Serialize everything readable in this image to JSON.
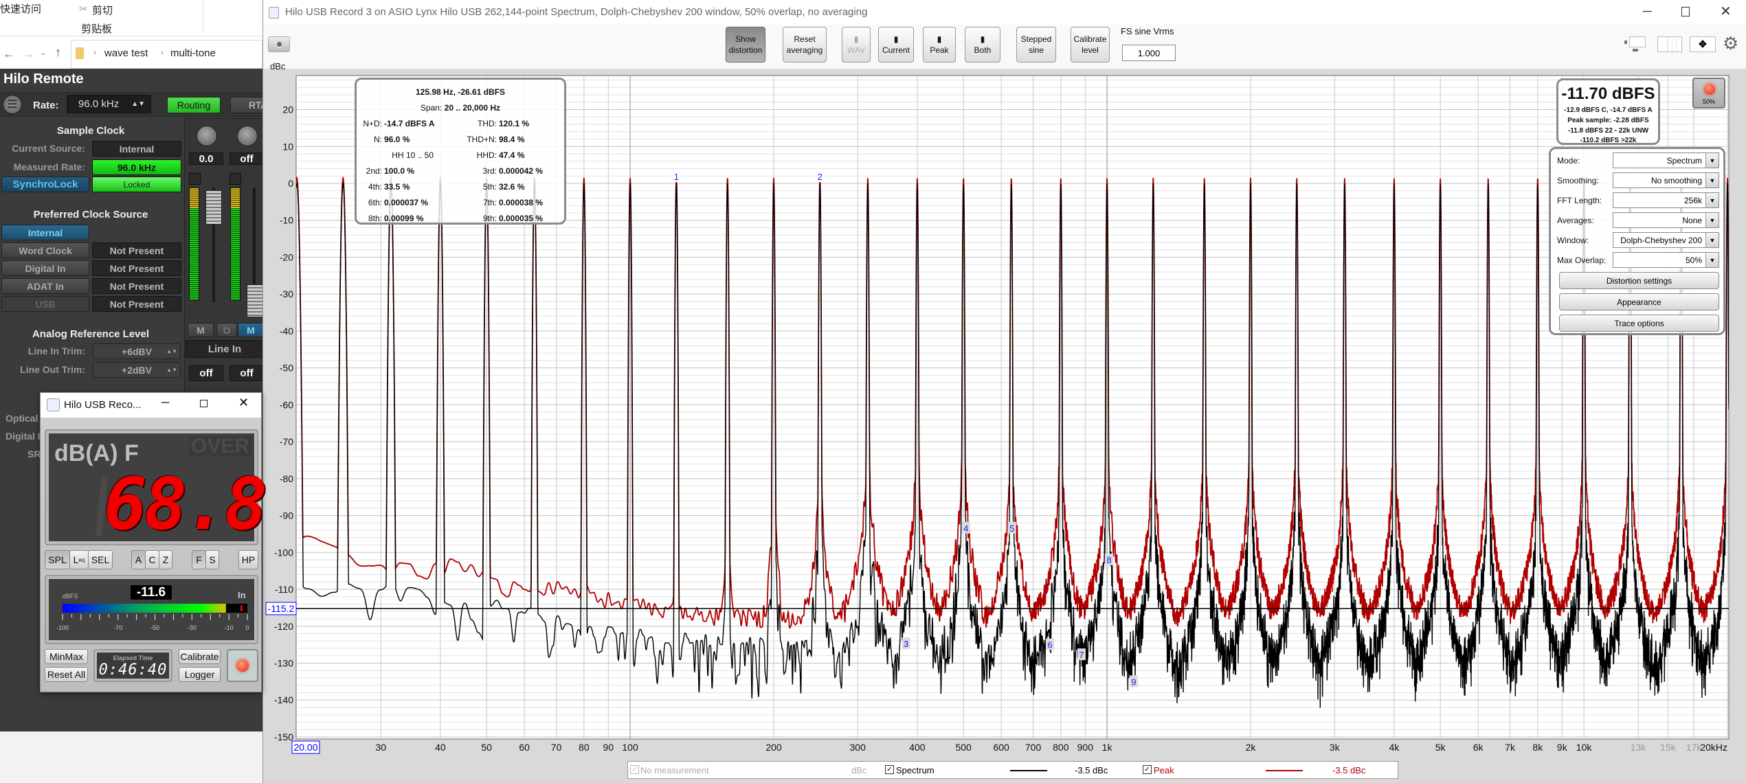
{
  "explorer": {
    "quick_access": "快速访问",
    "cut": "剪切",
    "clipboard": "剪贴板",
    "breadcrumb": [
      "wave test",
      "multi-tone"
    ]
  },
  "hilo_remote": {
    "title": "Hilo Remote",
    "rate_label": "Rate:",
    "rate_value": "96.0 kHz",
    "routing": "Routing",
    "rta": "RTA",
    "sample_clock": {
      "heading": "Sample Clock",
      "current_source_label": "Current Source:",
      "current_source_value": "Internal",
      "measured_rate_label": "Measured Rate:",
      "measured_rate_value": "96.0 kHz",
      "synchrolock_label": "SynchroLock",
      "synchrolock_status": "Locked"
    },
    "preferred_clock": {
      "heading": "Preferred Clock Source",
      "selected": "Internal",
      "sources": [
        {
          "name": "Word Clock",
          "status": "Not Present"
        },
        {
          "name": "Digital In",
          "status": "Not Present"
        },
        {
          "name": "ADAT In",
          "status": "Not Present"
        },
        {
          "name": "USB",
          "status": "Not Present"
        }
      ]
    },
    "analog_ref": {
      "heading": "Analog Reference Level",
      "line_in_label": "Line In Trim:",
      "line_in_value": "+6dBV",
      "line_out_label": "Line Out Trim:",
      "line_out_value": "+2dBV"
    },
    "mixer": {
      "ch1_value": "0.0",
      "ch2_value": "off",
      "mute1": "M",
      "solo": "O",
      "mute2": "M",
      "input": "Line In",
      "out1": "off",
      "out2": "off"
    },
    "partial_labels": [
      "Optical",
      "Digital I",
      "SR"
    ]
  },
  "spl_meter": {
    "title": "Hilo USB Reco...",
    "mode_label": "dB(A) F",
    "over_label": "OVER",
    "reading": "68.8",
    "buttons_mode": [
      "SPL",
      "L",
      "SEL"
    ],
    "leq_sub": "eq",
    "buttons_weight": [
      "A",
      "C",
      "Z"
    ],
    "buttons_speed": [
      "F",
      "S"
    ],
    "hp": "HP",
    "dbfs_label": "dBFS",
    "level_value": "-11.6",
    "in_label": "In",
    "level_dbfs": -11.6,
    "peak_dbfs": -3,
    "scale_labels": [
      "-100",
      "-70",
      "-50",
      "-30",
      "-10",
      "0"
    ],
    "minmax": "MinMax",
    "reset_all": "Reset All",
    "elapsed_label": "Elapsed Time",
    "elapsed_time": "0:46:40",
    "calibrate": "Calibrate",
    "logger": "Logger",
    "record_color": "#ff3b1f"
  },
  "rta": {
    "title": "Hilo USB Record 3 on ASIO Lynx Hilo USB 262,144-point Spectrum, Dolph-Chebyshev 200 window, 50% overlap, no averaging",
    "toolbar": {
      "show_distortion": [
        "Show",
        "distortion"
      ],
      "reset_averaging": [
        "Reset",
        "averaging"
      ],
      "wav": "WAV",
      "current": "Current",
      "peak": "Peak",
      "both": "Both",
      "stepped_sine": [
        "Stepped",
        "sine"
      ],
      "calibrate_level": [
        "Calibrate",
        "level"
      ],
      "fs_label": "FS sine Vrms",
      "fs_value": "1.000"
    },
    "info": {
      "cursor": "125.98 Hz, -26.61 dBFS",
      "span_label": "Span:",
      "span_value": "20 .. 20,000 Hz",
      "hh_label": "HH 10 .. 50",
      "left": [
        {
          "label": "N+D:",
          "value": "-14.7 dBFS A"
        },
        {
          "label": "N:",
          "value": "96.0 %"
        },
        {
          "label": "",
          "value": ""
        },
        {
          "label": "2nd:",
          "value": "100.0 %"
        },
        {
          "label": "4th:",
          "value": "33.5 %"
        },
        {
          "label": "6th:",
          "value": "0.000037 %"
        },
        {
          "label": "8th:",
          "value": "0.00099 %"
        }
      ],
      "right": [
        {
          "label": "THD:",
          "value": "120.1 %"
        },
        {
          "label": "THD+N:",
          "value": "98.4 %"
        },
        {
          "label": "HHD:",
          "value": "47.4 %"
        },
        {
          "label": "3rd:",
          "value": "0.000042 %"
        },
        {
          "label": "5th:",
          "value": "32.6 %"
        },
        {
          "label": "7th:",
          "value": "0.000038 %"
        },
        {
          "label": "9th:",
          "value": "0.000035 %"
        }
      ]
    },
    "level": {
      "main": "-11.70 dBFS",
      "lines": [
        "-12.9 dBFS C, -14.7 dBFS A",
        "Peak sample: -2.28 dBFS",
        "-11.8 dBFS 22 - 22k UNW",
        "-110.2 dBFS >22k"
      ]
    },
    "record_label": "50%",
    "settings": {
      "rows": [
        {
          "label": "Mode:",
          "value": "Spectrum"
        },
        {
          "label": "Smoothing:",
          "value": "No  smoothing"
        },
        {
          "label": "FFT Length:",
          "value": "256k"
        },
        {
          "label": "Averages:",
          "value": "None"
        },
        {
          "label": "Window:",
          "value": "Dolph-Chebyshev 200"
        },
        {
          "label": "Max Overlap:",
          "value": "50%"
        }
      ],
      "buttons": [
        "Distortion settings",
        "Appearance",
        "Trace options"
      ]
    },
    "legend": {
      "no_measurement": "No measurement",
      "no_measurement_unit": "dBc",
      "spectrum": "Spectrum",
      "spectrum_value": "-3.5 dBc",
      "peak": "Peak",
      "peak_value": "-3.5 dBc"
    }
  },
  "chart_data": {
    "type": "line",
    "xlabel": "",
    "ylabel": "dBc",
    "x_scale": "log",
    "xlim": [
      20,
      20000
    ],
    "ylim": [
      -150.5,
      29.2
    ],
    "grid": true,
    "y_ticks": [
      20,
      10,
      0,
      -10,
      -20,
      -30,
      -40,
      -50,
      -60,
      -70,
      -80,
      -90,
      -100,
      -110,
      -120,
      -130,
      -140,
      -150
    ],
    "x_ticks": [
      {
        "value": 30,
        "label": "30"
      },
      {
        "value": 40,
        "label": "40"
      },
      {
        "value": 50,
        "label": "50"
      },
      {
        "value": 60,
        "label": "60"
      },
      {
        "value": 70,
        "label": "70"
      },
      {
        "value": 80,
        "label": "80"
      },
      {
        "value": 90,
        "label": "90"
      },
      {
        "value": 100,
        "label": "100"
      },
      {
        "value": 200,
        "label": "200"
      },
      {
        "value": 300,
        "label": "300"
      },
      {
        "value": 400,
        "label": "400"
      },
      {
        "value": 500,
        "label": "500"
      },
      {
        "value": 600,
        "label": "600"
      },
      {
        "value": 700,
        "label": "700"
      },
      {
        "value": 800,
        "label": "800"
      },
      {
        "value": 900,
        "label": "900"
      },
      {
        "value": 1000,
        "label": "1k"
      },
      {
        "value": 2000,
        "label": "2k"
      },
      {
        "value": 3000,
        "label": "3k"
      },
      {
        "value": 4000,
        "label": "4k"
      },
      {
        "value": 5000,
        "label": "5k"
      },
      {
        "value": 6000,
        "label": "6k"
      },
      {
        "value": 7000,
        "label": "7k"
      },
      {
        "value": 8000,
        "label": "8k"
      },
      {
        "value": 9000,
        "label": "9k"
      },
      {
        "value": 10000,
        "label": "10k"
      },
      {
        "value": 13000,
        "label": "13k",
        "dim": true
      },
      {
        "value": 15000,
        "label": "15k",
        "dim": true
      },
      {
        "value": 17000,
        "label": "17k",
        "dim": true
      },
      {
        "value": 20000,
        "label": "20kHz"
      }
    ],
    "cursor": {
      "x_label": "20.00",
      "y_value": -115.2,
      "y_label": "-115.2"
    },
    "tones": {
      "freq_hz": [
        20,
        25,
        31.5,
        40,
        50,
        63,
        80,
        100,
        125,
        160,
        200,
        250,
        315,
        400,
        500,
        630,
        800,
        1000,
        1250,
        1600,
        2000,
        2500,
        3150,
        4000,
        5000,
        6300,
        8000,
        10000,
        12500,
        16000,
        20000
      ],
      "dbc": 0
    },
    "series": [
      {
        "name": "Peak",
        "color": "#b00000",
        "noise_floor": {
          "freq_hz": [
            20,
            22,
            28,
            35,
            45,
            55,
            70,
            90,
            110,
            140,
            180,
            250,
            350,
            500,
            700,
            1000,
            2000,
            5000,
            10000,
            20000
          ],
          "dbc": [
            -98,
            -98,
            -103,
            -105,
            -104,
            -110,
            -109,
            -113,
            -115,
            -117,
            -118,
            -118,
            -118,
            -118,
            -120,
            -119,
            -118,
            -117,
            -117,
            -118
          ]
        }
      },
      {
        "name": "Spectrum",
        "color": "#000000",
        "noise_floor": {
          "freq_hz": [
            20,
            22,
            28,
            35,
            45,
            55,
            70,
            90,
            110,
            150,
            200,
            300,
            500,
            1000,
            2000,
            5000,
            10000,
            20000
          ],
          "dbc": [
            -113,
            -113,
            -114,
            -115,
            -120,
            -120,
            -124,
            -127,
            -128,
            -130,
            -130,
            -133,
            -134,
            -137,
            -139,
            -141,
            -142,
            -144
          ]
        }
      }
    ],
    "markers": [
      {
        "label": "1",
        "freq_hz": 125,
        "dbc": 0,
        "fundamental": true
      },
      {
        "label": "2",
        "freq_hz": 250,
        "dbc": 0,
        "fundamental": true
      },
      {
        "label": "3",
        "freq_hz": 379,
        "dbc": -124.7
      },
      {
        "label": "4",
        "freq_hz": 506,
        "dbc": -93.4
      },
      {
        "label": "5",
        "freq_hz": 632,
        "dbc": -93.4
      },
      {
        "label": "6",
        "freq_hz": 759,
        "dbc": -125
      },
      {
        "label": "7",
        "freq_hz": 884,
        "dbc": -127.7
      },
      {
        "label": "8",
        "freq_hz": 1010,
        "dbc": -102
      },
      {
        "label": "9",
        "freq_hz": 1138,
        "dbc": -135
      }
    ]
  }
}
